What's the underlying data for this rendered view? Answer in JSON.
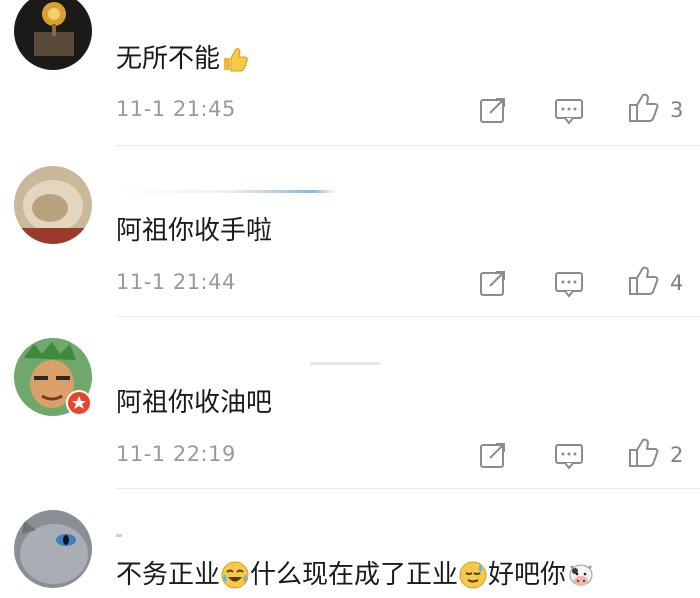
{
  "comments": [
    {
      "text": "无所不能",
      "timestamp": "11-1 21:45",
      "likes": "3",
      "emoji_after": "thumbs-up-icon"
    },
    {
      "text": "阿祖你收手啦",
      "timestamp": "11-1 21:44",
      "likes": "4"
    },
    {
      "text": "阿祖你收油吧",
      "timestamp": "11-1 22:19",
      "likes": "2"
    },
    {
      "text_parts": [
        "不务正业",
        "什么现在成了正业",
        "好吧你"
      ],
      "emojis": [
        "crying-laughing-icon",
        "sweat-smile-icon",
        "cow-face-icon"
      ]
    }
  ],
  "icons": {
    "share": "share-icon",
    "reply": "reply-icon",
    "like": "like-icon"
  },
  "colors": {
    "text": "#1a1a1a",
    "meta": "#9a9a9a",
    "icon": "#8c8c8c",
    "badge": "#e8432c"
  }
}
